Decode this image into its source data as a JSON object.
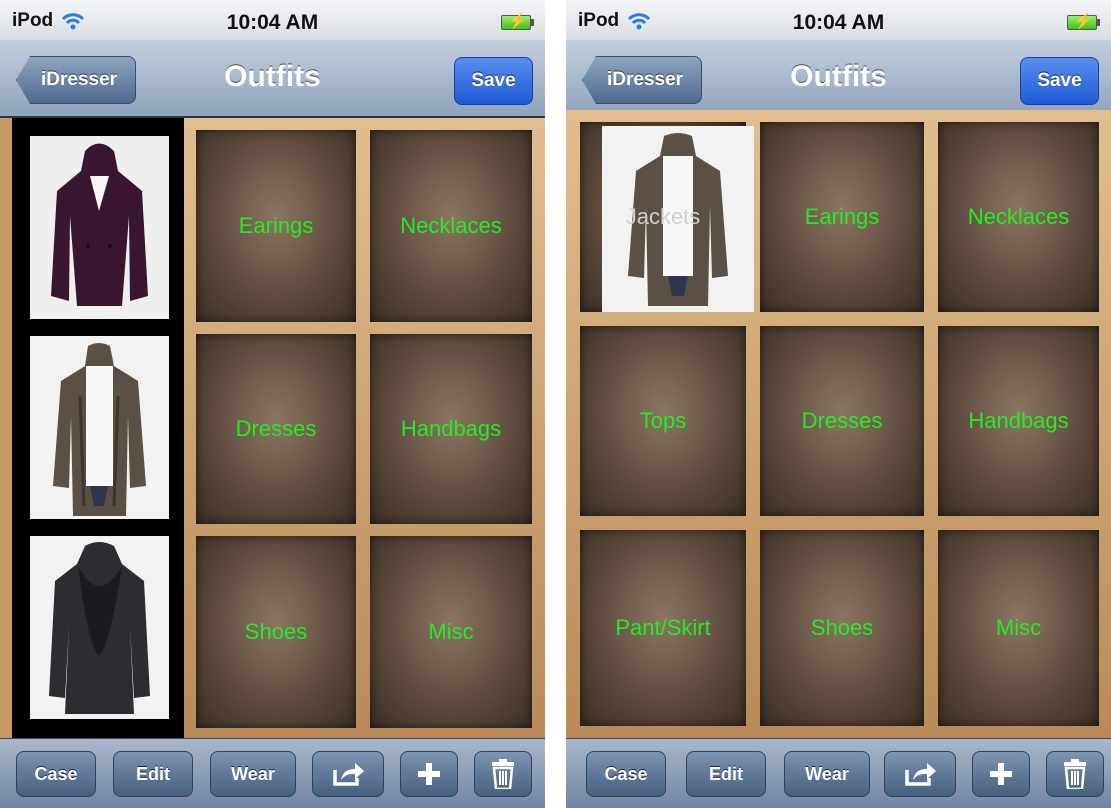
{
  "status": {
    "carrier": "iPod",
    "time": "10:04 AM"
  },
  "nav": {
    "back_label": "iDresser",
    "title": "Outfits",
    "save_label": "Save"
  },
  "left_shelf": {
    "labels": [
      "Earings",
      "Necklaces",
      "Dresses",
      "Handbags",
      "Shoes",
      "Misc"
    ]
  },
  "right_shelf": {
    "labels": [
      "Jackets",
      "Earings",
      "Necklaces",
      "Tops",
      "Dresses",
      "Handbags",
      "Pant/Skirt",
      "Shoes",
      "Misc"
    ]
  },
  "toolbar": {
    "case_label": "Case",
    "edit_label": "Edit",
    "wear_label": "Wear"
  },
  "colors": {
    "label_green": "#22ee22",
    "save_blue": "#1e5ad6"
  },
  "icons": [
    "wifi-icon",
    "battery-icon",
    "share-icon",
    "plus-icon",
    "trash-icon"
  ]
}
